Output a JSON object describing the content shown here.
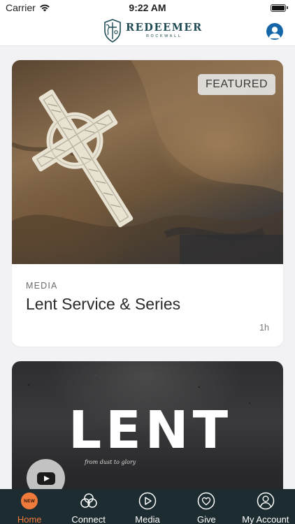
{
  "status_bar": {
    "carrier": "Carrier",
    "time": "9:22 AM",
    "battery_level": 1.0
  },
  "header": {
    "logo_word": "REDEEMER",
    "logo_sub": "ROCKWALL",
    "account_icon": "person-icon",
    "brand_color": "#1f4b55",
    "account_color": "#1466a8"
  },
  "feed": {
    "cards": [
      {
        "badge": "FEATURED",
        "category": "MEDIA",
        "title": "Lent Service & Series",
        "duration": "1h",
        "image": "celtic-cross-on-burlap"
      },
      {
        "image_word": "LENT",
        "image_tagline": "from dust to glory",
        "play_icon": "youtube-play-icon"
      }
    ]
  },
  "tab_bar": {
    "accent_color": "#f07a3c",
    "background": "#1d2c30",
    "tabs": [
      {
        "label": "Home",
        "icon": "home-new-badge-icon",
        "badge": "NEW",
        "active": true
      },
      {
        "label": "Connect",
        "icon": "connect-circles-icon",
        "active": false
      },
      {
        "label": "Media",
        "icon": "play-circle-icon",
        "active": false
      },
      {
        "label": "Give",
        "icon": "heart-circle-icon",
        "active": false
      },
      {
        "label": "My Account",
        "icon": "person-circle-icon",
        "active": false
      }
    ]
  }
}
